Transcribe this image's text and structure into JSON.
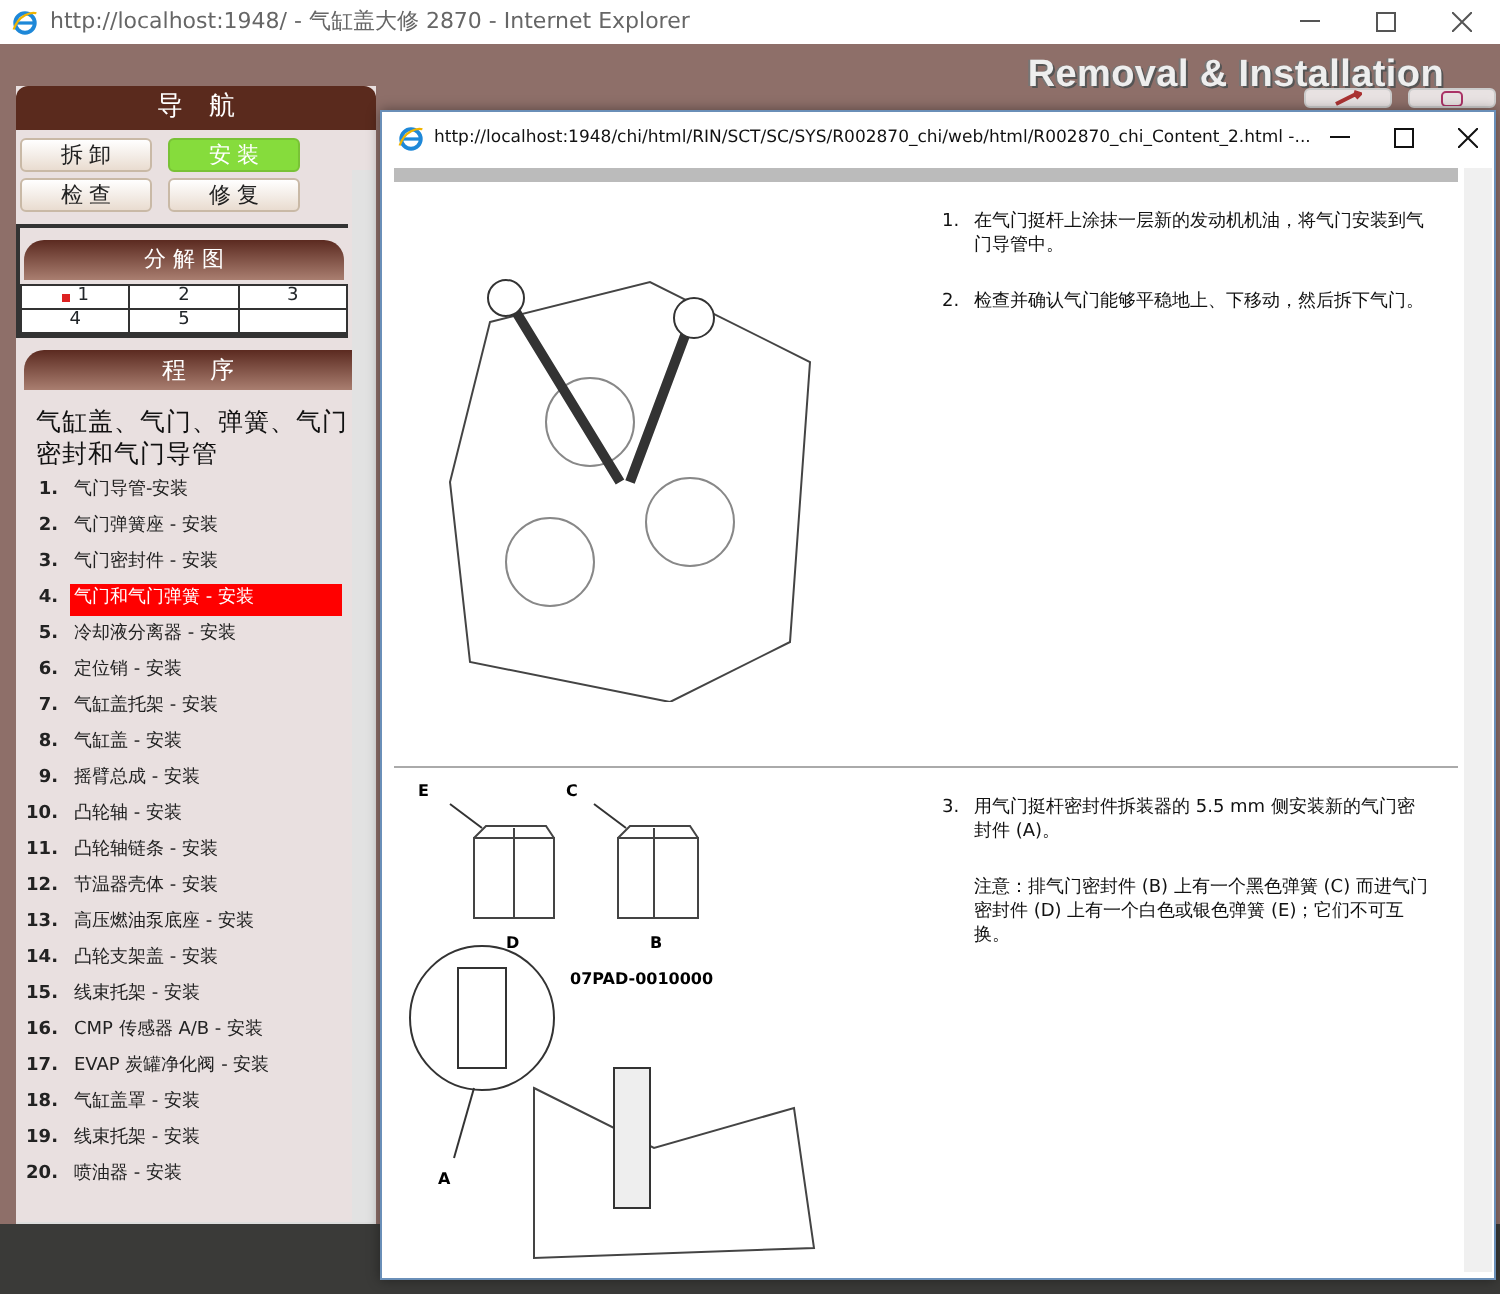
{
  "main_window": {
    "title": "http://localhost:1948/ - 气缸盖大修 2870 - Internet Explorer"
  },
  "banner": {
    "title": "Removal & Installation"
  },
  "nav": {
    "header": "导　航",
    "buttons": [
      {
        "label": "拆 卸",
        "selected": false
      },
      {
        "label": "安 装",
        "selected": true
      },
      {
        "label": "检 查",
        "selected": false
      },
      {
        "label": "修 复",
        "selected": false
      }
    ],
    "exploded_view": {
      "header": "分 解 图",
      "cells": [
        {
          "label": "1",
          "marked": true
        },
        {
          "label": "2",
          "marked": false
        },
        {
          "label": "3",
          "marked": false
        },
        {
          "label": "4",
          "marked": false
        },
        {
          "label": "5",
          "marked": false
        }
      ]
    },
    "procedure": {
      "header": "程　序",
      "title": "气缸盖、气门、弹簧、气门密封和气门导管",
      "steps": [
        {
          "number": "1.",
          "text": "气门导管-安装",
          "selected": false
        },
        {
          "number": "2.",
          "text": "气门弹簧座 - 安装",
          "selected": false
        },
        {
          "number": "3.",
          "text": "气门密封件 - 安装",
          "selected": false
        },
        {
          "number": "4.",
          "text": "气门和气门弹簧 - 安装",
          "selected": true
        },
        {
          "number": "5.",
          "text": "冷却液分离器 - 安装",
          "selected": false
        },
        {
          "number": "6.",
          "text": "定位销 - 安装",
          "selected": false
        },
        {
          "number": "7.",
          "text": "气缸盖托架 - 安装",
          "selected": false
        },
        {
          "number": "8.",
          "text": "气缸盖 - 安装",
          "selected": false
        },
        {
          "number": "9.",
          "text": "摇臂总成 - 安装",
          "selected": false
        },
        {
          "number": "10.",
          "text": "凸轮轴 - 安装",
          "selected": false
        },
        {
          "number": "11.",
          "text": "凸轮轴链条 - 安装",
          "selected": false
        },
        {
          "number": "12.",
          "text": "节温器壳体 - 安装",
          "selected": false
        },
        {
          "number": "13.",
          "text": "高压燃油泵底座 - 安装",
          "selected": false
        },
        {
          "number": "14.",
          "text": "凸轮支架盖 - 安装",
          "selected": false
        },
        {
          "number": "15.",
          "text": "线束托架 - 安装",
          "selected": false
        },
        {
          "number": "16.",
          "text": "CMP 传感器 A/B - 安装",
          "selected": false
        },
        {
          "number": "17.",
          "text": "EVAP 炭罐净化阀 - 安装",
          "selected": false
        },
        {
          "number": "18.",
          "text": "气缸盖罩 - 安装",
          "selected": false
        },
        {
          "number": "19.",
          "text": "线束托架 - 安装",
          "selected": false
        },
        {
          "number": "20.",
          "text": "喷油器 - 安装",
          "selected": false
        }
      ]
    }
  },
  "popup": {
    "title": "http://localhost:1948/chi/html/RIN/SCT/SC/SYS/R002870_chi/web/html/R002870_chi_Content_2.html -...",
    "sections": [
      {
        "steps": [
          {
            "number": "1.",
            "text": "在气门挺杆上涂抹一层新的发动机机油，将气门安装到气门导管中。"
          },
          {
            "number": "2.",
            "text": "检查并确认气门能够平稳地上、下移动，然后拆下气门。"
          }
        ]
      },
      {
        "labels": [
          "E",
          "C",
          "D",
          "B",
          "07PAD-0010000",
          "A"
        ],
        "steps": [
          {
            "number": "3.",
            "text": "用气门挺杆密封件拆装器的 5.5 mm 侧安装新的气门密封件 (A)。"
          }
        ],
        "note": "注意：排气门密封件 (B) 上有一个黑色弹簧 (C) 而进气门密封件 (D) 上有一个白色或银色弹簧 (E)；它们不可互换。"
      }
    ]
  }
}
